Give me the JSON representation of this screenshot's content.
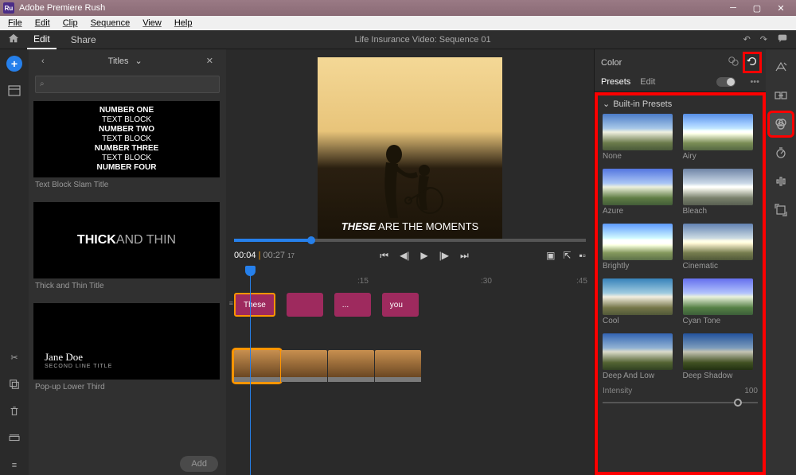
{
  "titlebar": {
    "app_name": "Adobe Premiere Rush"
  },
  "menubar": {
    "file": "File",
    "edit": "Edit",
    "clip": "Clip",
    "sequence": "Sequence",
    "view": "View",
    "help": "Help"
  },
  "toolbar": {
    "edit": "Edit",
    "share": "Share",
    "doc_title": "Life Insurance Video: Sequence 01"
  },
  "titles_panel": {
    "title": "Titles",
    "items": [
      {
        "label": "Text Block Slam Title",
        "lines": [
          "NUMBER ONE",
          "TEXT BLOCK",
          "NUMBER TWO",
          "TEXT BLOCK",
          "NUMBER THREE",
          "TEXT BLOCK",
          "NUMBER FOUR"
        ]
      },
      {
        "label": "Thick and Thin Title",
        "thick": "THICK",
        "thin": "AND THIN"
      },
      {
        "label": "Pop-up Lower Third",
        "name": "Jane Doe",
        "subtitle": "SECOND LINE TITLE"
      }
    ],
    "add_button": "Add"
  },
  "preview": {
    "text_bold": "THESE",
    "text_rest": " ARE THE MOMENTS"
  },
  "playback": {
    "current_time": "00:04",
    "total_time": "00:27",
    "frame": "17"
  },
  "timeline": {
    "marks": [
      ":15",
      ":30",
      ":45"
    ],
    "title_clips": [
      "These",
      "",
      "...",
      "you"
    ]
  },
  "color_panel": {
    "title": "Color",
    "tabs": {
      "presets": "Presets",
      "edit": "Edit"
    },
    "section": "Built-in Presets",
    "presets": [
      {
        "label": "None",
        "cls": "none"
      },
      {
        "label": "Airy",
        "cls": "airy"
      },
      {
        "label": "Azure",
        "cls": "azure"
      },
      {
        "label": "Bleach",
        "cls": "bleach"
      },
      {
        "label": "Brightly",
        "cls": "brightly"
      },
      {
        "label": "Cinematic",
        "cls": "cinematic"
      },
      {
        "label": "Cool",
        "cls": "cool"
      },
      {
        "label": "Cyan Tone",
        "cls": "cyan"
      },
      {
        "label": "Deep And Low",
        "cls": "deeplow"
      },
      {
        "label": "Deep Shadow",
        "cls": "deepshadow"
      }
    ],
    "intensity_label": "Intensity",
    "intensity_value": "100"
  }
}
